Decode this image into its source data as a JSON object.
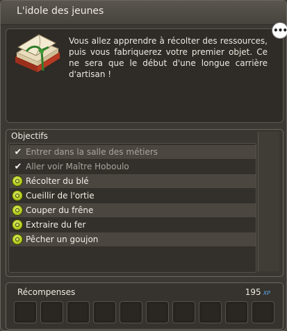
{
  "window": {
    "title": "L'idole des jeunes"
  },
  "description": {
    "text": "Vous allez apprendre à récolter des ressources, puis vous fabriquerez votre premier objet. Ce ne sera que le début d'une longue carrière d'artisan !",
    "icon": "book-icon"
  },
  "chat_button": {
    "label": "•••",
    "icon": "speech-bubble-icon"
  },
  "objectives": {
    "header": "Objectifs",
    "items": [
      {
        "label": "Entrer dans la salle des métiers",
        "status": "done",
        "icon": "checkmark-icon"
      },
      {
        "label": "Aller voir Maître Hoboulo",
        "status": "done",
        "icon": "checkmark-icon"
      },
      {
        "label": "Récolter du blé",
        "status": "todo",
        "icon": "objective-icon"
      },
      {
        "label": "Cueillir de l'ortie",
        "status": "todo",
        "icon": "objective-icon"
      },
      {
        "label": "Couper du frêne",
        "status": "todo",
        "icon": "objective-icon"
      },
      {
        "label": "Extraire du fer",
        "status": "todo",
        "icon": "objective-icon"
      },
      {
        "label": "Pêcher un goujon",
        "status": "todo",
        "icon": "objective-icon"
      }
    ]
  },
  "rewards": {
    "label": "Récompenses",
    "xp_value": "195",
    "xp_unit": "XP",
    "slot_count": 10
  },
  "colors": {
    "background": "#3f3b36",
    "panel_dark": "#2f2b27",
    "objective_green": "#b6cc1f",
    "xp_blue": "#5aa8e8"
  }
}
